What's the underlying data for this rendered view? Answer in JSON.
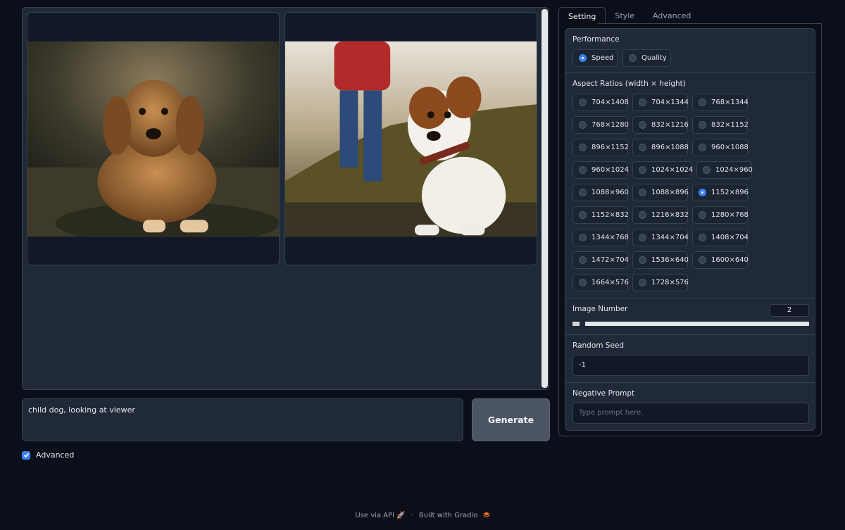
{
  "gallery": {
    "images": [
      {
        "name": "golden retriever puppy"
      },
      {
        "name": "white and brown puppy"
      }
    ]
  },
  "prompt": {
    "value": "child dog, looking at viewer"
  },
  "generate_label": "Generate",
  "advanced_checkbox": {
    "label": "Advanced",
    "checked": true
  },
  "tabs": [
    {
      "label": "Setting",
      "active": true
    },
    {
      "label": "Style",
      "active": false
    },
    {
      "label": "Advanced",
      "active": false
    }
  ],
  "settings": {
    "performance": {
      "label": "Performance",
      "options": [
        "Speed",
        "Quality"
      ],
      "selected": "Speed"
    },
    "aspect_ratios": {
      "label": "Aspect Ratios (width × height)",
      "options": [
        "704×1408",
        "704×1344",
        "768×1344",
        "768×1280",
        "832×1216",
        "832×1152",
        "896×1152",
        "896×1088",
        "960×1088",
        "960×1024",
        "1024×1024",
        "1024×960",
        "1088×960",
        "1088×896",
        "1152×896",
        "1152×832",
        "1216×832",
        "1280×768",
        "1344×768",
        "1344×704",
        "1408×704",
        "1472×704",
        "1536×640",
        "1600×640",
        "1664×576",
        "1728×576"
      ],
      "selected": "1152×896"
    },
    "image_number": {
      "label": "Image Number",
      "value": "2"
    },
    "random_seed": {
      "label": "Random Seed",
      "value": "-1"
    },
    "negative_prompt": {
      "label": "Negative Prompt",
      "placeholder": "Type prompt here."
    }
  },
  "footer": {
    "api": "Use via API",
    "separator": "·",
    "built": "Built with Gradio"
  }
}
